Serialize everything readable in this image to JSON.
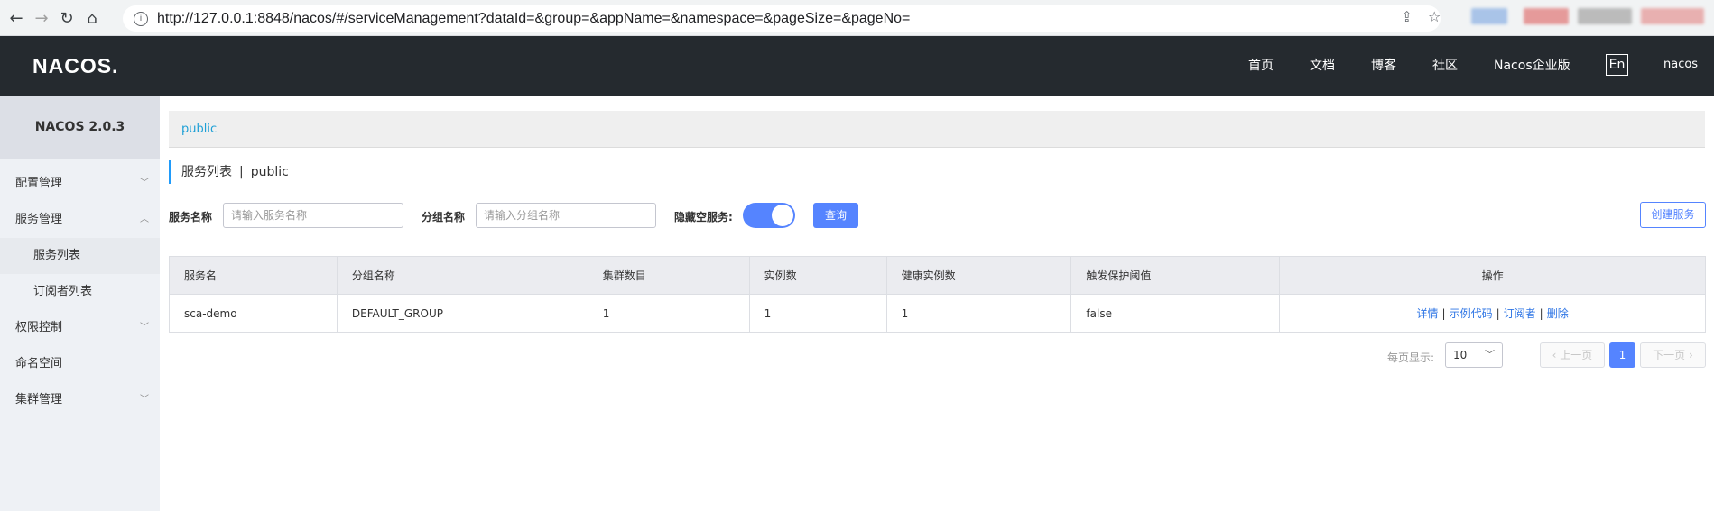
{
  "browser": {
    "url": "http://127.0.0.1:8848/nacos/#/serviceManagement?dataId=&group=&appName=&namespace=&pageSize=&pageNo="
  },
  "header": {
    "logo": "NACOS.",
    "nav": [
      "首页",
      "文档",
      "博客",
      "社区",
      "Nacos企业版"
    ],
    "lang": "En",
    "user": "nacos"
  },
  "sidebar": {
    "brand": "NACOS 2.0.3",
    "items": [
      {
        "label": "配置管理"
      },
      {
        "label": "服务管理"
      },
      {
        "label": "服务列表"
      },
      {
        "label": "订阅者列表"
      },
      {
        "label": "权限控制"
      },
      {
        "label": "命名空间"
      },
      {
        "label": "集群管理"
      }
    ]
  },
  "breadcrumb": {
    "namespace": "public"
  },
  "page": {
    "title": "服务列表",
    "sep": "|",
    "namespace": "public"
  },
  "filters": {
    "service_label": "服务名称",
    "service_placeholder": "请输入服务名称",
    "group_label": "分组名称",
    "group_placeholder": "请输入分组名称",
    "hide_empty_label": "隐藏空服务:",
    "search_button": "查询",
    "create_button": "创建服务"
  },
  "table": {
    "headers": [
      "服务名",
      "分组名称",
      "集群数目",
      "实例数",
      "健康实例数",
      "触发保护阈值",
      "操作"
    ],
    "rows": [
      {
        "name": "sca-demo",
        "group": "DEFAULT_GROUP",
        "clusters": "1",
        "instances": "1",
        "healthy": "1",
        "threshold": "false",
        "ops": [
          "详情",
          "示例代码",
          "订阅者",
          "删除"
        ]
      }
    ]
  },
  "pager": {
    "label": "每页显示:",
    "page_size": "10",
    "prev": "上一页",
    "current": "1",
    "next": "下一页"
  }
}
